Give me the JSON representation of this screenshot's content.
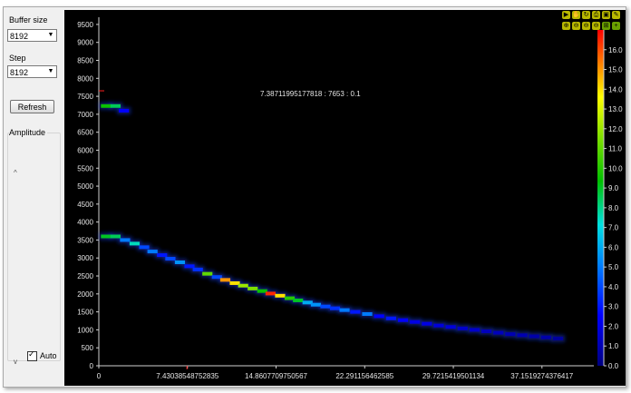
{
  "left_panel": {
    "buffer_size_label": "Buffer size",
    "buffer_size_value": "8192",
    "step_label": "Step",
    "step_value": "8192",
    "refresh_label": "Refresh",
    "amplitude_label": "Amplitude",
    "auto_label": "Auto",
    "auto_checked": true
  },
  "plot": {
    "annotation": "7.38711995177818 : 7653 : 0.1",
    "colors": {
      "background": "#000000",
      "grid_text": "#e6e6e6"
    }
  },
  "chart_data": {
    "type": "heatmap",
    "x_ticks": [
      "0",
      "7.43038548752835",
      "14.8607709750567",
      "22.291156462585",
      "29.7215419501134",
      "37.1519274376417"
    ],
    "y_ticks": [
      "0",
      "500",
      "1000",
      "1500",
      "2000",
      "2500",
      "3000",
      "3500",
      "4000",
      "4500",
      "5000",
      "5500",
      "6000",
      "6500",
      "7000",
      "7500",
      "8000",
      "8500",
      "9000",
      "9500"
    ],
    "xlim": [
      0,
      41.5
    ],
    "ylim": [
      0,
      9700
    ],
    "colorbar_ticks": [
      "0.0",
      "1.0",
      "2.0",
      "3.0",
      "4.0",
      "5.0",
      "6.0",
      "7.0",
      "8.0",
      "9.0",
      "10.0",
      "11.0",
      "12.0",
      "13.0",
      "14.0",
      "15.0",
      "16.0"
    ],
    "colorbar_range": [
      0,
      17
    ],
    "cursor": {
      "x": 7.38711995177818,
      "y": 7653,
      "value": 0.1
    },
    "points": [
      {
        "x": 0.6,
        "y": 7230,
        "v": 9.5
      },
      {
        "x": 1.4,
        "y": 7230,
        "v": 8.5
      },
      {
        "x": 2.1,
        "y": 7100,
        "v": 2.5
      },
      {
        "x": 0.6,
        "y": 3600,
        "v": 9.0
      },
      {
        "x": 1.4,
        "y": 3600,
        "v": 8.5
      },
      {
        "x": 2.2,
        "y": 3500,
        "v": 5.0
      },
      {
        "x": 3.0,
        "y": 3400,
        "v": 7.5
      },
      {
        "x": 3.8,
        "y": 3300,
        "v": 4.0
      },
      {
        "x": 4.5,
        "y": 3180,
        "v": 5.0
      },
      {
        "x": 5.3,
        "y": 3080,
        "v": 3.0
      },
      {
        "x": 6.0,
        "y": 2980,
        "v": 4.0
      },
      {
        "x": 6.8,
        "y": 2880,
        "v": 5.5
      },
      {
        "x": 7.6,
        "y": 2770,
        "v": 3.0
      },
      {
        "x": 8.3,
        "y": 2680,
        "v": 3.5
      },
      {
        "x": 9.1,
        "y": 2560,
        "v": 11.0
      },
      {
        "x": 9.9,
        "y": 2470,
        "v": 4.0
      },
      {
        "x": 10.6,
        "y": 2390,
        "v": 15.0
      },
      {
        "x": 11.4,
        "y": 2300,
        "v": 14.0
      },
      {
        "x": 12.1,
        "y": 2230,
        "v": 12.0
      },
      {
        "x": 12.9,
        "y": 2150,
        "v": 11.5
      },
      {
        "x": 13.7,
        "y": 2080,
        "v": 9.5
      },
      {
        "x": 14.4,
        "y": 2010,
        "v": 16.5
      },
      {
        "x": 15.2,
        "y": 1950,
        "v": 14.0
      },
      {
        "x": 16.0,
        "y": 1880,
        "v": 10.0
      },
      {
        "x": 16.7,
        "y": 1820,
        "v": 9.0
      },
      {
        "x": 17.5,
        "y": 1760,
        "v": 6.0
      },
      {
        "x": 18.2,
        "y": 1700,
        "v": 5.5
      },
      {
        "x": 19.0,
        "y": 1650,
        "v": 4.0
      },
      {
        "x": 19.8,
        "y": 1600,
        "v": 3.5
      },
      {
        "x": 20.6,
        "y": 1550,
        "v": 5.0
      },
      {
        "x": 21.5,
        "y": 1500,
        "v": 3.0
      },
      {
        "x": 22.5,
        "y": 1440,
        "v": 5.0
      },
      {
        "x": 23.5,
        "y": 1380,
        "v": 2.5
      },
      {
        "x": 24.5,
        "y": 1320,
        "v": 3.0
      },
      {
        "x": 25.5,
        "y": 1270,
        "v": 2.5
      },
      {
        "x": 26.5,
        "y": 1220,
        "v": 2.0
      },
      {
        "x": 27.5,
        "y": 1170,
        "v": 2.0
      },
      {
        "x": 28.5,
        "y": 1120,
        "v": 1.8
      },
      {
        "x": 29.5,
        "y": 1080,
        "v": 1.8
      },
      {
        "x": 30.5,
        "y": 1040,
        "v": 1.5
      },
      {
        "x": 31.5,
        "y": 1000,
        "v": 1.5
      },
      {
        "x": 32.5,
        "y": 960,
        "v": 1.2
      },
      {
        "x": 33.5,
        "y": 920,
        "v": 1.2
      },
      {
        "x": 34.5,
        "y": 880,
        "v": 1.0
      },
      {
        "x": 35.5,
        "y": 850,
        "v": 1.0
      },
      {
        "x": 36.5,
        "y": 820,
        "v": 0.8
      },
      {
        "x": 37.5,
        "y": 790,
        "v": 0.8
      },
      {
        "x": 38.5,
        "y": 760,
        "v": 0.6
      }
    ]
  }
}
